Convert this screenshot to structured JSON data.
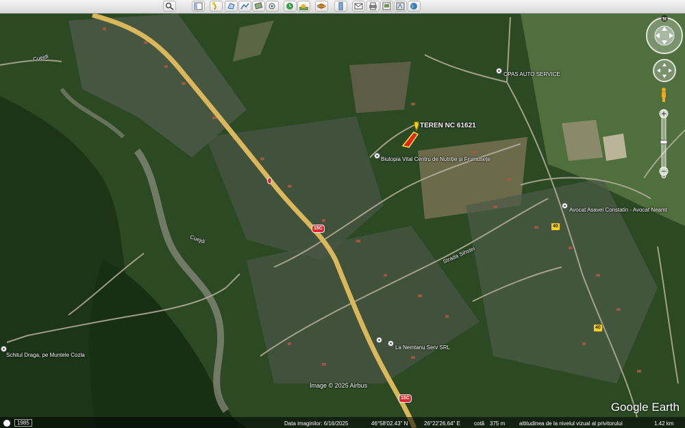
{
  "toolbar": {
    "buttons": [
      "search-icon",
      "sidebar-icon",
      "placemark-icon",
      "polygon-icon",
      "path-icon",
      "overlay-icon",
      "tour-icon",
      "history-icon",
      "sunlight-icon",
      "planets-icon",
      "ruler-icon",
      "email-icon",
      "print-icon",
      "save-image-icon",
      "map-view-icon",
      "globe-icon"
    ]
  },
  "labels": {
    "cuejdi_top": "Cuejdi",
    "cuejdi_mid": "Cuejdi",
    "opas": "OPAS AUTO SERVICE",
    "teren": "TEREN NC 61621",
    "biutopia": "Biutopia Vital Centru de Nutriție și Frumusețe",
    "avocat": "Avocat Asavei Constatin - Avocat Neamt",
    "strada": "Strada Sihstei",
    "schitul": "Schitul Draga, pe Muntele Cozla",
    "nemtanu": "La Nemtanu Serv SRL",
    "imagecredit": "Image © 2025 Airbus"
  },
  "shields": {
    "r15c_a": "15C",
    "r15c_b": "15C",
    "r40_a": "40",
    "r40_b": "40"
  },
  "status": {
    "year": "1985",
    "date": "Data imaginilor: 6/16/2025",
    "lat": "46°58'02.43\" N",
    "lon": "26°22'26.64\" E",
    "cota_label": "cotă",
    "cota": "375 m",
    "altitude_label": "altitudinea de la nivelul vizual al privitorului",
    "altitude": "1.42 km"
  },
  "brand": {
    "logo": "Google Earth"
  },
  "nav": {
    "north": "N"
  },
  "colors": {
    "road_main": "#d9b75a",
    "placemark_fill": "#e0261b",
    "placemark_outline": "#f4e53a",
    "pin": "#f2d018"
  }
}
